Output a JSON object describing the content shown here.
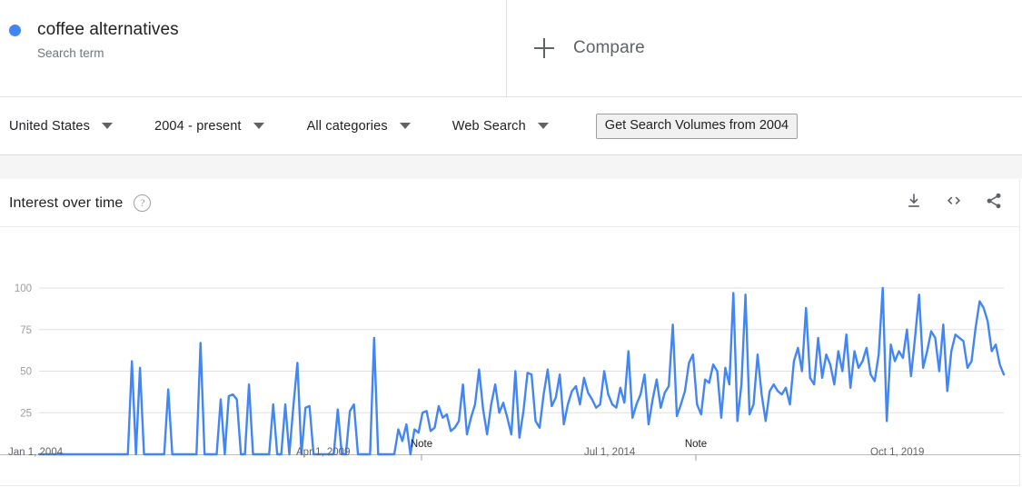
{
  "term": {
    "title": "coffee alternatives",
    "subtitle": "Search term",
    "dot_color": "#4285f4"
  },
  "compare": {
    "label": "Compare",
    "icon": "plus-icon"
  },
  "filters": [
    {
      "label": "United States",
      "icon": "chevron-down-icon"
    },
    {
      "label": "2004 - present",
      "icon": "chevron-down-icon"
    },
    {
      "label": "All categories",
      "icon": "chevron-down-icon"
    },
    {
      "label": "Web Search",
      "icon": "chevron-down-icon"
    }
  ],
  "volumes_button": {
    "label": "Get Search Volumes from 2004"
  },
  "card": {
    "title": "Interest over time",
    "help_icon": "?",
    "actions": [
      {
        "name": "download-icon",
        "title": "Download"
      },
      {
        "name": "embed-code-icon",
        "title": "Embed"
      },
      {
        "name": "share-icon",
        "title": "Share"
      }
    ]
  },
  "chart_data": {
    "type": "line",
    "title": "Interest over time",
    "xlabel": "",
    "ylabel": "",
    "ylim": [
      0,
      100
    ],
    "yticks": [
      25,
      50,
      75,
      100
    ],
    "grid": true,
    "legend_position": "top",
    "series_name": "coffee alternatives",
    "series_color": "#4285f4",
    "xtick_labels": [
      "Jan 1, 2004",
      "Apr 1, 2009",
      "Jul 1, 2014",
      "Oct 1, 2019"
    ],
    "xtick_positions": [
      43,
      358,
      675,
      992
    ],
    "annotations": [
      {
        "label": "Note",
        "x": 464
      },
      {
        "label": "Note",
        "x": 766
      }
    ],
    "values": [
      0,
      0,
      0,
      0,
      0,
      0,
      0,
      0,
      0,
      0,
      0,
      0,
      0,
      0,
      0,
      0,
      0,
      0,
      0,
      0,
      0,
      0,
      0,
      56,
      0,
      52,
      0,
      0,
      0,
      0,
      0,
      0,
      39,
      0,
      0,
      0,
      0,
      0,
      0,
      0,
      67,
      0,
      0,
      0,
      0,
      33,
      0,
      35,
      36,
      33,
      0,
      0,
      42,
      0,
      0,
      0,
      0,
      0,
      30,
      0,
      0,
      30,
      0,
      29,
      55,
      0,
      28,
      29,
      0,
      0,
      0,
      0,
      0,
      0,
      27,
      0,
      0,
      26,
      30,
      0,
      0,
      0,
      0,
      70,
      0,
      0,
      0,
      0,
      0,
      15,
      8,
      18,
      0,
      15,
      13,
      25,
      26,
      14,
      16,
      29,
      22,
      24,
      14,
      16,
      20,
      42,
      12,
      22,
      30,
      51,
      27,
      12,
      30,
      42,
      25,
      31,
      22,
      12,
      50,
      10,
      26,
      49,
      48,
      20,
      16,
      36,
      51,
      29,
      34,
      48,
      18,
      30,
      38,
      41,
      30,
      46,
      37,
      33,
      28,
      30,
      50,
      36,
      30,
      28,
      40,
      31,
      62,
      22,
      30,
      36,
      48,
      18,
      33,
      45,
      28,
      37,
      41,
      78,
      23,
      30,
      38,
      55,
      60,
      30,
      24,
      45,
      43,
      54,
      50,
      22,
      52,
      42,
      97,
      20,
      42,
      96,
      24,
      30,
      60,
      36,
      20,
      38,
      42,
      38,
      36,
      40,
      30,
      56,
      64,
      50,
      88,
      46,
      42,
      70,
      46,
      60,
      54,
      42,
      62,
      50,
      72,
      40,
      62,
      52,
      56,
      64,
      48,
      44,
      60,
      100,
      20,
      66,
      56,
      62,
      58,
      75,
      47,
      70,
      96,
      52,
      62,
      74,
      70,
      50,
      78,
      38,
      62,
      72,
      70,
      68,
      52,
      56,
      76,
      92,
      88,
      80,
      62,
      66,
      54,
      48
    ]
  }
}
